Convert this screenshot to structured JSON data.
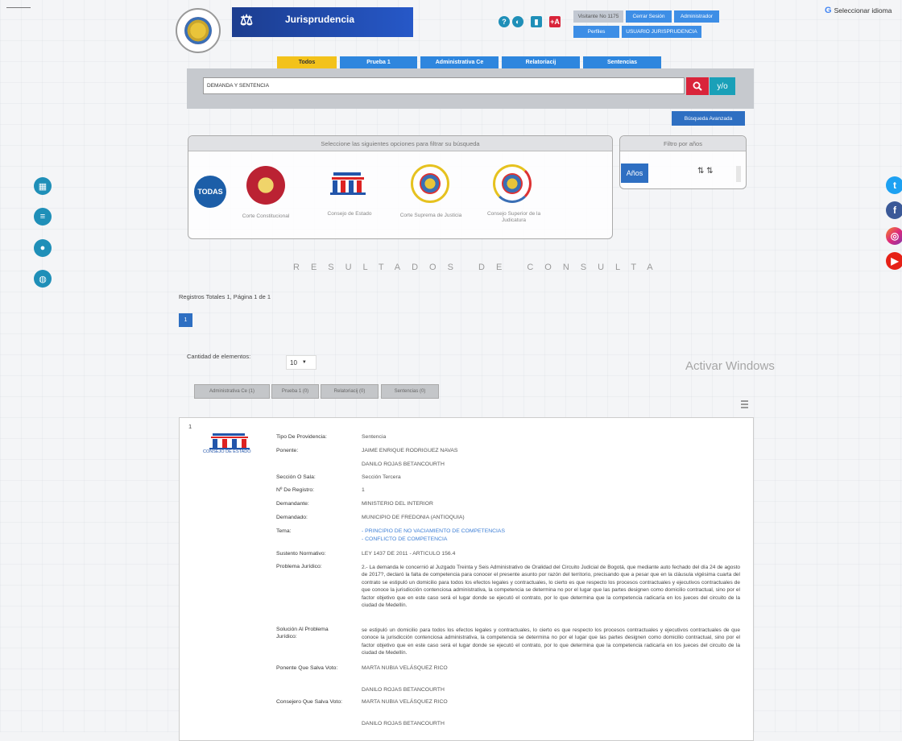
{
  "header": {
    "brand_title": "Jurisprudencia",
    "accessibility": [
      "?",
      "◐",
      "▮",
      "+A"
    ],
    "session_buttons": [
      "Visitante No 1175",
      "Cerrar Sesión",
      "Administrador"
    ],
    "session_buttons_2": [
      "Perfiles",
      "USUARIO JURISPRUDENCIA"
    ],
    "language": "Seleccionar idioma"
  },
  "tabs": [
    "Todos",
    "Prueba 1",
    "Administrativa Ce",
    "Relatoriacij",
    "Sentencias"
  ],
  "search": {
    "value": "DEMANDA Y SENTENCIA",
    "yo_label": "y/o",
    "advanced_label": "Búsqueda Avanzada"
  },
  "filters": {
    "heading": "Seleccione las siguientes opciones para filtrar su búsqueda",
    "todas": "TODAS",
    "corporations": [
      "Corte Constitucional",
      "Consejo de Estado",
      "Corte Suprema de Justicia",
      "Consejo Superior de la Judicatura"
    ],
    "year_heading": "Filtro por años",
    "years_label": "Años"
  },
  "results": {
    "title": "RESULTADOS DE CONSULTA",
    "summary": "Registros Totales 1, Página 1 de 1",
    "page": "1",
    "count_label": "Cantidad de elementos:",
    "count_value": "10",
    "filter_tabs": [
      "Administrativa Ce (1)",
      "Prueba 1 (0)",
      "Relatoriacij (0)",
      "Sentencias (0)"
    ],
    "watermark": "Activar Windows"
  },
  "record": {
    "index": "1",
    "logo_caption": "CONSEJO DE ESTADO",
    "fields": {
      "tipo_label": "Tipo De Providencia:",
      "tipo_value": "Sentencia",
      "ponente_label": "Ponente:",
      "ponente_1": "JAIME ENRIQUE RODRIGUEZ NAVAS",
      "ponente_2": "DANILO ROJAS BETANCOURTH",
      "seccion_label": "Sección O Sala:",
      "seccion_value": "Sección Tercera",
      "registro_label": "Nº De Registro:",
      "registro_value": "1",
      "demandante_label": "Demandante:",
      "demandante_value": "MINISTERIO DEL INTERIOR",
      "demandado_label": "Demandado:",
      "demandado_value": "MUNICIPIO DE FREDONIA (ANTIOQUIA)",
      "tema_label": "Tema:",
      "tema_1": "- PRINCIPIO DE NO VACIAMIENTO DE COMPETENCIAS",
      "tema_2": "- CONFLICTO DE COMPETENCIA",
      "sustento_label": "Sustento Normativo:",
      "sustento_value": "LEY 1437 DE 2011 - ARTICULO 156.4",
      "problema_label": "Problema Jurídico:",
      "problema_value": "2.- La demanda le concernió al Juzgado Treinta y Seis Administrativo de Oralidad del Circuito Judicial de Bogotá, que mediante auto fechado del día 24 de agosto de 2017?, declaró la falta de competencia para conocer el presente asunto por razón del territorio, precisando que a pesar que en la cláusula vigésima cuarta del contrato se estipuló un domicilio para todos los efectos legales y contractuales, lo cierto es que respecto los procesos contractuales y ejecutivos contractuales de que conoce la jurisdicción contenciosa administrativa, la competencia se determina no por el lugar que las partes designen como domicilio contractual, sino por el factor objetivo que en este caso será el lugar donde se ejecutó el contrato, por lo que determina que la competencia radicaría en los jueces del circuito de la ciudad de Medellín.",
      "solucion_label": "Solución Al Problema Jurídico:",
      "solucion_value": "se estipuló un domicilio para todos los efectos legales y contractuales, lo cierto es que respecto los procesos contractuales y ejecutivos contractuales de que conoce la jurisdicción contenciosa administrativa, la competencia se determina no por el lugar que las partes designen como domicilio contractual, sino por el factor objetivo que en este caso será el lugar donde se ejecutó el contrato, por lo que determina que la competencia radicaría en los jueces del circuito de la ciudad de Medellín.",
      "salva_label": "Ponente Que Salva Voto:",
      "salva_1": "MARTA NUBIA VELÁSQUEZ RICO",
      "salva_2": "DANILO ROJAS BETANCOURTH",
      "consejero_label": "Consejero Que Salva Voto:",
      "consejero_1": "MARTA NUBIA VELÁSQUEZ RICO",
      "consejero_2": "DANILO ROJAS BETANCOURTH"
    }
  },
  "social": [
    "twitter-icon",
    "facebook-icon",
    "instagram-icon",
    "youtube-icon"
  ],
  "colors": {
    "accent": "#2e6fc2",
    "tab_active": "#f3c21b",
    "search_red": "#d9243a"
  }
}
